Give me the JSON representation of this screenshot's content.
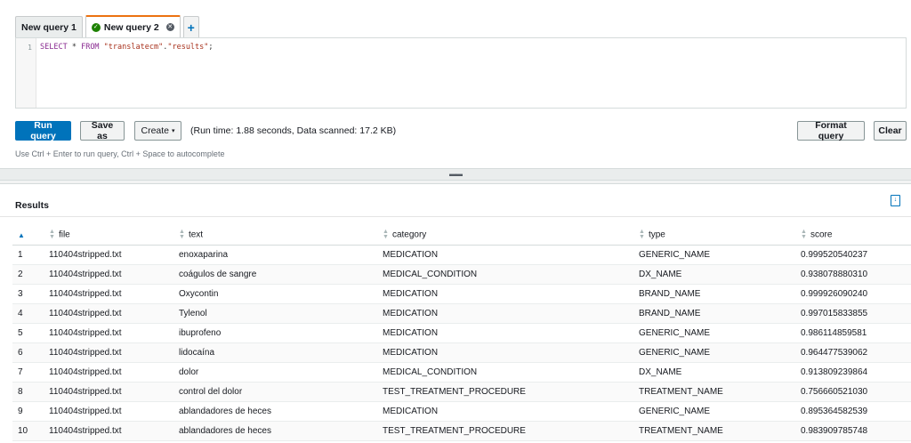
{
  "tabs": [
    {
      "label": "New query 1",
      "active": false
    },
    {
      "label": "New query 2",
      "active": true
    }
  ],
  "editor": {
    "line_number": "1",
    "sql_keyword_select": "SELECT",
    "sql_star": " * ",
    "sql_keyword_from": "FROM",
    "sql_db": " \"translatecm\"",
    "sql_dot": ".",
    "sql_table": "\"results\"",
    "sql_end": ";"
  },
  "toolbar": {
    "run_label": "Run query",
    "save_label": "Save as",
    "create_label": "Create",
    "run_stats": "(Run time: 1.88 seconds, Data scanned: 17.2 KB)",
    "format_label": "Format query",
    "clear_label": "Clear",
    "hint": "Use Ctrl + Enter to run query, Ctrl + Space to autocomplete"
  },
  "results": {
    "title": "Results",
    "columns": [
      "file",
      "text",
      "category",
      "type",
      "score"
    ],
    "rows": [
      {
        "idx": "1",
        "file": "110404stripped.txt",
        "text": "enoxaparina",
        "category": "MEDICATION",
        "type": "GENERIC_NAME",
        "score": "0.999520540237"
      },
      {
        "idx": "2",
        "file": "110404stripped.txt",
        "text": "coágulos de sangre",
        "category": "MEDICAL_CONDITION",
        "type": "DX_NAME",
        "score": "0.938078880310"
      },
      {
        "idx": "3",
        "file": "110404stripped.txt",
        "text": "Oxycontin",
        "category": "MEDICATION",
        "type": "BRAND_NAME",
        "score": "0.999926090240"
      },
      {
        "idx": "4",
        "file": "110404stripped.txt",
        "text": "Tylenol",
        "category": "MEDICATION",
        "type": "BRAND_NAME",
        "score": "0.997015833855"
      },
      {
        "idx": "5",
        "file": "110404stripped.txt",
        "text": "ibuprofeno",
        "category": "MEDICATION",
        "type": "GENERIC_NAME",
        "score": "0.986114859581"
      },
      {
        "idx": "6",
        "file": "110404stripped.txt",
        "text": "lidocaína",
        "category": "MEDICATION",
        "type": "GENERIC_NAME",
        "score": "0.964477539062"
      },
      {
        "idx": "7",
        "file": "110404stripped.txt",
        "text": "dolor",
        "category": "MEDICAL_CONDITION",
        "type": "DX_NAME",
        "score": "0.913809239864"
      },
      {
        "idx": "8",
        "file": "110404stripped.txt",
        "text": "control del dolor",
        "category": "TEST_TREATMENT_PROCEDURE",
        "type": "TREATMENT_NAME",
        "score": "0.756660521030"
      },
      {
        "idx": "9",
        "file": "110404stripped.txt",
        "text": "ablandadores de heces",
        "category": "MEDICATION",
        "type": "GENERIC_NAME",
        "score": "0.895364582539"
      },
      {
        "idx": "10",
        "file": "110404stripped.txt",
        "text": "ablandadores de heces",
        "category": "TEST_TREATMENT_PROCEDURE",
        "type": "TREATMENT_NAME",
        "score": "0.983909785748"
      }
    ]
  },
  "colors": {
    "primary": "#0073bb",
    "active_tab_accent": "#ec7211",
    "success": "#1d8102"
  },
  "icons": [
    "check-circle-icon",
    "close-circle-icon",
    "plus-icon",
    "chevron-down-icon",
    "drag-handle-icon",
    "download-icon",
    "sort-icon"
  ]
}
